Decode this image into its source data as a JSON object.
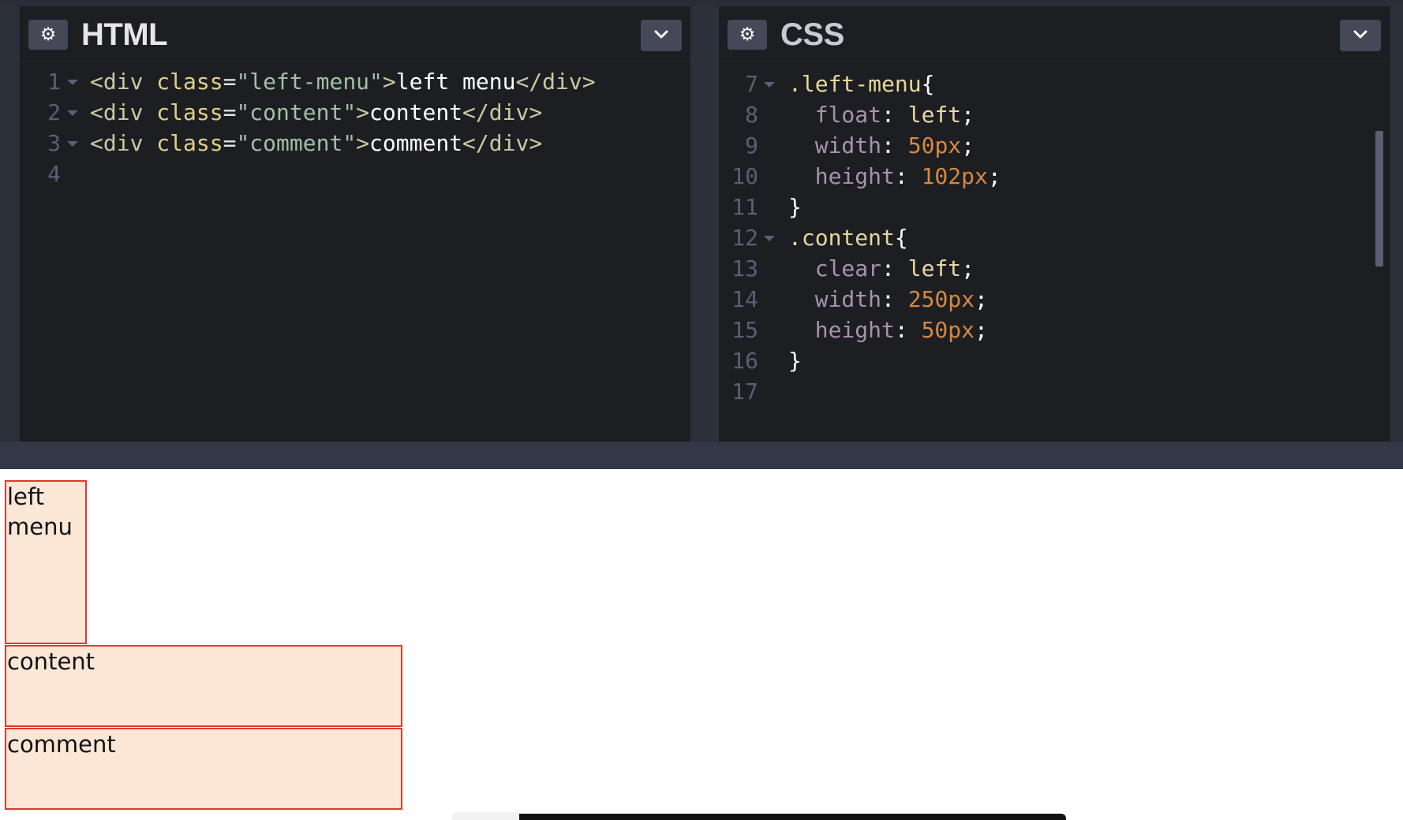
{
  "html_panel": {
    "title": "HTML",
    "lines": [
      {
        "n": "1",
        "fold": true,
        "tokens": [
          {
            "t": "<div ",
            "c": "tag"
          },
          {
            "t": "class",
            "c": "attr"
          },
          {
            "t": "=",
            "c": "eq"
          },
          {
            "t": "\"left-menu\"",
            "c": "str"
          },
          {
            "t": ">",
            "c": "tag"
          },
          {
            "t": "left menu",
            "c": "plain"
          },
          {
            "t": "</div>",
            "c": "tag"
          }
        ]
      },
      {
        "n": "2",
        "fold": true,
        "tokens": [
          {
            "t": "<div ",
            "c": "tag"
          },
          {
            "t": "class",
            "c": "attr"
          },
          {
            "t": "=",
            "c": "eq"
          },
          {
            "t": "\"content\"",
            "c": "str"
          },
          {
            "t": ">",
            "c": "tag"
          },
          {
            "t": "content",
            "c": "plain"
          },
          {
            "t": "</div>",
            "c": "tag"
          }
        ]
      },
      {
        "n": "3",
        "fold": true,
        "tokens": [
          {
            "t": "<div ",
            "c": "tag"
          },
          {
            "t": "class",
            "c": "attr"
          },
          {
            "t": "=",
            "c": "eq"
          },
          {
            "t": "\"comment\"",
            "c": "str"
          },
          {
            "t": ">",
            "c": "tag"
          },
          {
            "t": "comment",
            "c": "plain"
          },
          {
            "t": "</div>",
            "c": "tag"
          }
        ]
      },
      {
        "n": "4",
        "fold": false,
        "tokens": []
      }
    ]
  },
  "css_panel": {
    "title": "CSS",
    "lines": [
      {
        "n": "7",
        "fold": true,
        "tokens": [
          {
            "t": ".left-menu",
            "c": "sel"
          },
          {
            "t": "{",
            "c": "punct"
          }
        ]
      },
      {
        "n": "8",
        "fold": false,
        "tokens": [
          {
            "t": "  float",
            "c": "prop"
          },
          {
            "t": ": ",
            "c": "punct"
          },
          {
            "t": "left",
            "c": "kw"
          },
          {
            "t": ";",
            "c": "punct"
          }
        ]
      },
      {
        "n": "9",
        "fold": false,
        "tokens": [
          {
            "t": "  width",
            "c": "prop"
          },
          {
            "t": ": ",
            "c": "punct"
          },
          {
            "t": "50px",
            "c": "num"
          },
          {
            "t": ";",
            "c": "punct"
          }
        ]
      },
      {
        "n": "10",
        "fold": false,
        "tokens": [
          {
            "t": "  height",
            "c": "prop"
          },
          {
            "t": ": ",
            "c": "punct"
          },
          {
            "t": "102px",
            "c": "num"
          },
          {
            "t": ";",
            "c": "punct"
          }
        ]
      },
      {
        "n": "11",
        "fold": false,
        "tokens": [
          {
            "t": "}",
            "c": "punct"
          }
        ]
      },
      {
        "n": "12",
        "fold": true,
        "tokens": [
          {
            "t": ".content",
            "c": "sel"
          },
          {
            "t": "{",
            "c": "punct"
          }
        ]
      },
      {
        "n": "13",
        "fold": false,
        "tokens": [
          {
            "t": "  clear",
            "c": "prop"
          },
          {
            "t": ": ",
            "c": "punct"
          },
          {
            "t": "left",
            "c": "kw"
          },
          {
            "t": ";",
            "c": "punct"
          }
        ]
      },
      {
        "n": "14",
        "fold": false,
        "tokens": [
          {
            "t": "  width",
            "c": "prop"
          },
          {
            "t": ": ",
            "c": "punct"
          },
          {
            "t": "250px",
            "c": "num"
          },
          {
            "t": ";",
            "c": "punct"
          }
        ]
      },
      {
        "n": "15",
        "fold": false,
        "tokens": [
          {
            "t": "  height",
            "c": "prop"
          },
          {
            "t": ": ",
            "c": "punct"
          },
          {
            "t": "50px",
            "c": "num"
          },
          {
            "t": ";",
            "c": "punct"
          }
        ]
      },
      {
        "n": "16",
        "fold": false,
        "tokens": [
          {
            "t": "}",
            "c": "punct"
          }
        ]
      },
      {
        "n": "17",
        "fold": false,
        "tokens": []
      }
    ]
  },
  "preview": {
    "left_menu": "left menu",
    "content": "content",
    "comment": "comment"
  },
  "icons": {
    "settings": "gear-icon",
    "collapse": "chevron-down-icon"
  },
  "colors": {
    "editor_bg": "#1d1e22",
    "chrome_bg": "#2c303a",
    "button_bg": "#444857",
    "box_fill": "#fce7d7",
    "box_border": "#e03a2c"
  }
}
